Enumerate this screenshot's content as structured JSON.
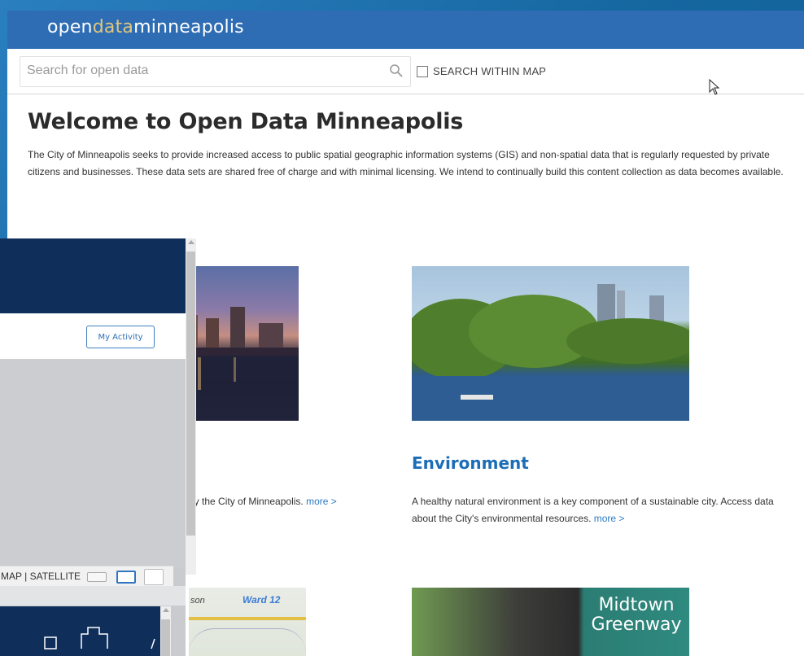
{
  "brand": {
    "part1": "open",
    "part2": "data",
    "part3": "minneapolis"
  },
  "search": {
    "placeholder": "Search for open data",
    "within_map_label": "SEARCH WITHIN MAP"
  },
  "welcome": {
    "title": "Welcome to Open Data Minneapolis",
    "text": "The City of Minneapolis seeks to provide increased access to public spatial geographic information systems (GIS) and non-spatial data that is regularly requested by private citizens and businesses. These data sets are shared free of charge and with minimal licensing. We intend to continually build this content collection as data becomes available."
  },
  "tiles": {
    "city": {
      "desc_visible": "by the City of Minneapolis.",
      "more": "more >"
    },
    "environment": {
      "title": "Environment",
      "desc": "A healthy natural environment is a key component of a sustainable city. Access data about the City's environmental resources.",
      "more": "more >"
    },
    "map_tile": {
      "ward_label": "Ward 12",
      "son_label": "son"
    },
    "greenway": {
      "sign_line1": "Midtown",
      "sign_line2": "Greenway"
    }
  },
  "overlay_window": {
    "activity_button": "My Activity",
    "map_toggle_text": "MAP | SATELLITE"
  },
  "colors": {
    "brand_bar": "#2e6db4",
    "accent_gold": "#e3c77a",
    "link": "#2a7ac4",
    "overlay_header": "#0f2e5a"
  }
}
